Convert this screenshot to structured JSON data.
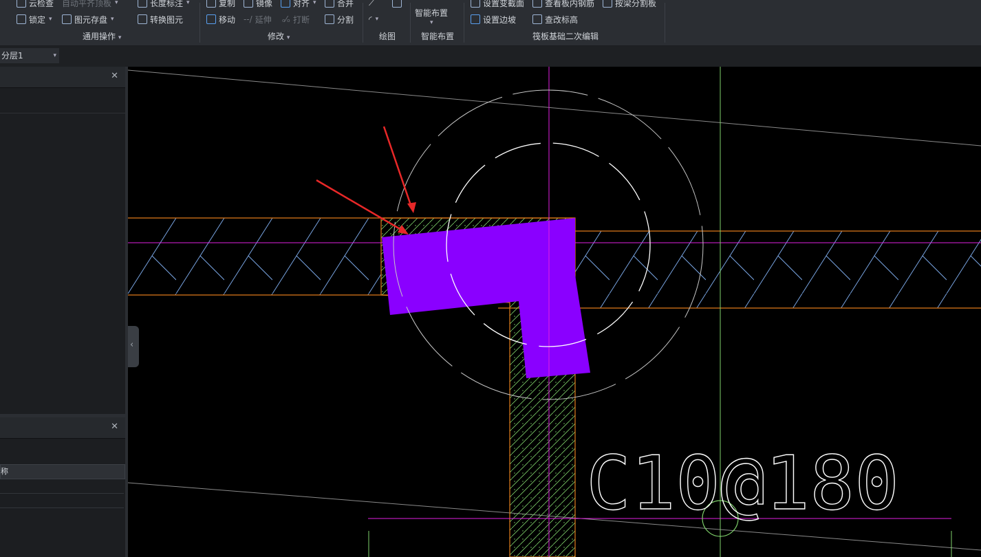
{
  "ribbon": {
    "common": {
      "cloud_check": "云检查",
      "auto_align_top": "自动平齐顶板",
      "lock": "锁定",
      "element_storage": "图元存盘",
      "length_dim": "长度标注",
      "convert_element": "转换图元",
      "group_label": "通用操作"
    },
    "modify": {
      "copy": "复制",
      "mirror": "镜像",
      "align": "对齐",
      "merge": "合并",
      "move": "移动",
      "extend": "延伸",
      "break": "打断",
      "split": "分割",
      "group_label": "修改"
    },
    "draw": {
      "group_label": "绘图"
    },
    "smart": {
      "smart_layout": "智能布置",
      "group_label": "智能布置"
    },
    "raft": {
      "set_variable_section": "设置变截面",
      "view_inner_rebar": "查看板内钢筋",
      "split_by_beam": "按梁分割板",
      "set_slope": "设置边坡",
      "edit_elevation": "查改标高",
      "group_label": "筏板基础二次编辑"
    }
  },
  "layer_select": {
    "value": "分层1"
  },
  "panels": {
    "lower_row_label": "称"
  },
  "canvas": {
    "annotation": "C10@180",
    "colors": {
      "pink": "#e020e0",
      "green": "#7fd26b",
      "orange": "#e07a1a",
      "purple": "#8a00ff",
      "blue": "#7aa7e6",
      "red": "#e82828"
    }
  }
}
